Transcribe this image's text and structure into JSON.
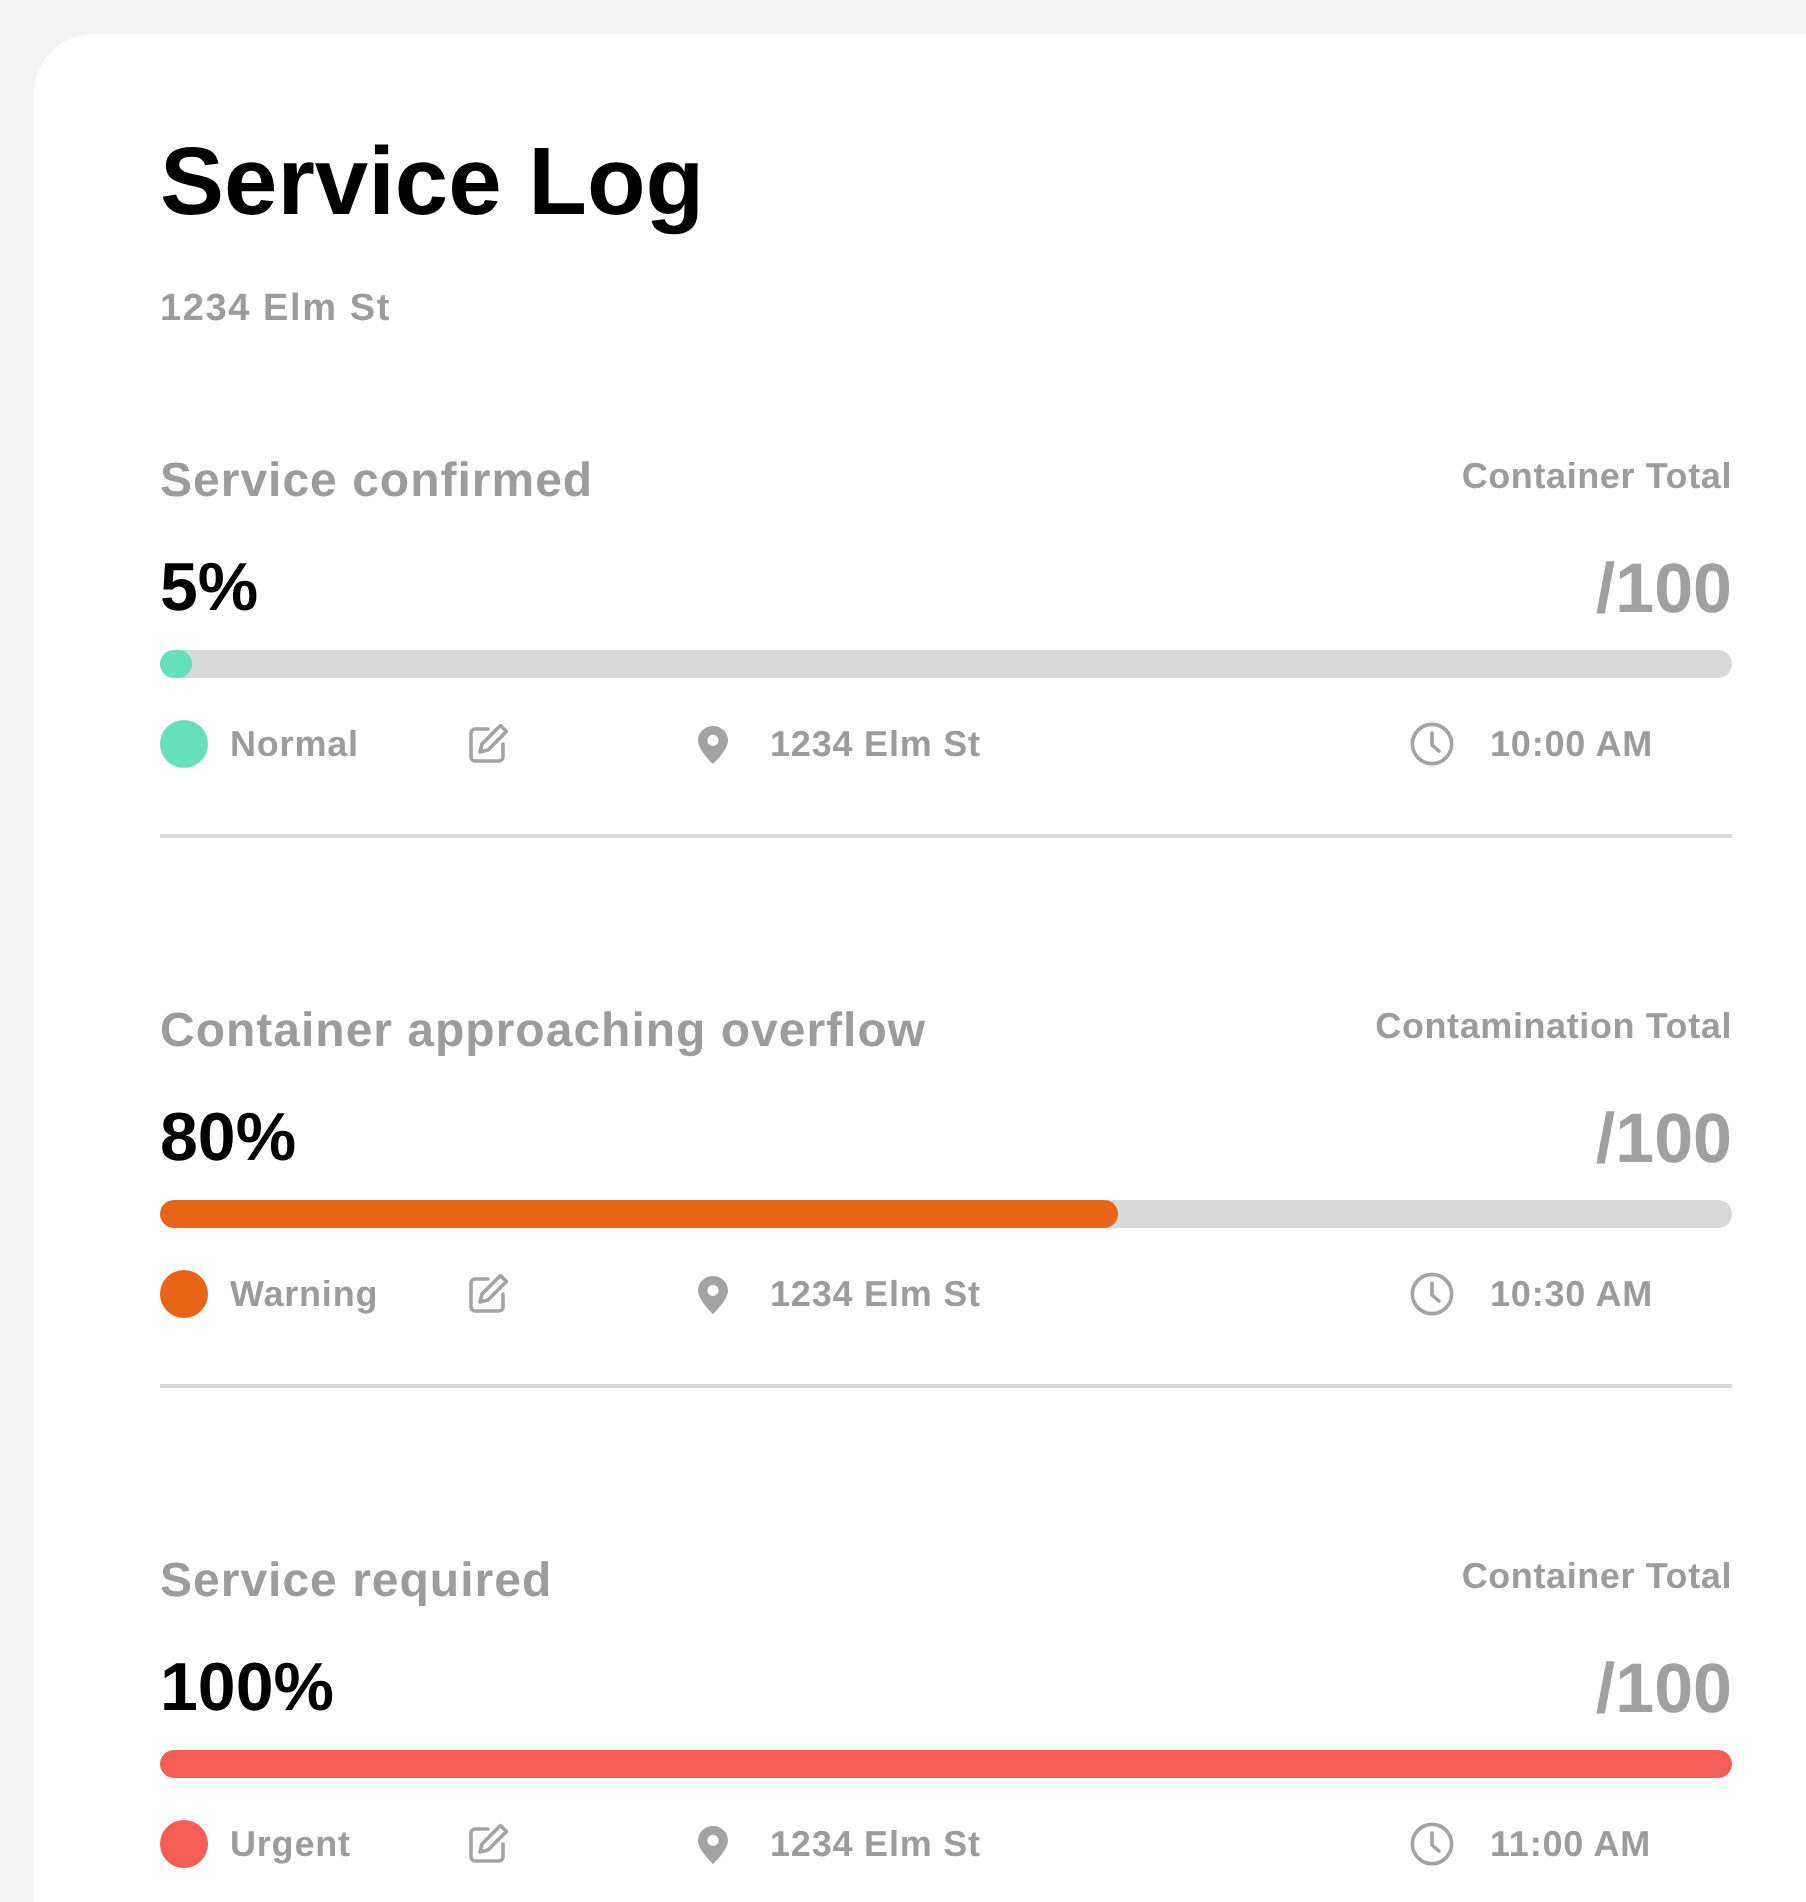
{
  "title": "Service Log",
  "subtitle": "1234 Elm St",
  "entries": [
    {
      "heading": "Service confirmed",
      "total_label": "Container Total",
      "percent": "5%",
      "total": "/100",
      "level": 0.02,
      "color": "#67dfbd",
      "status": "Normal",
      "address": "1234 Elm St",
      "time": "10:00 AM"
    },
    {
      "heading": "Container approaching overflow",
      "total_label": "Contamination Total",
      "percent": "80%",
      "total": "/100",
      "level": 0.61,
      "color": "#e86518",
      "status": "Warning",
      "address": "1234 Elm St",
      "time": "10:30 AM"
    },
    {
      "heading": "Service required",
      "total_label": "Container Total",
      "percent": "100%",
      "total": "/100",
      "level": 1,
      "color": "#f65d55",
      "status": "Urgent",
      "address": "1234 Elm St",
      "time": "11:00 AM"
    }
  ]
}
